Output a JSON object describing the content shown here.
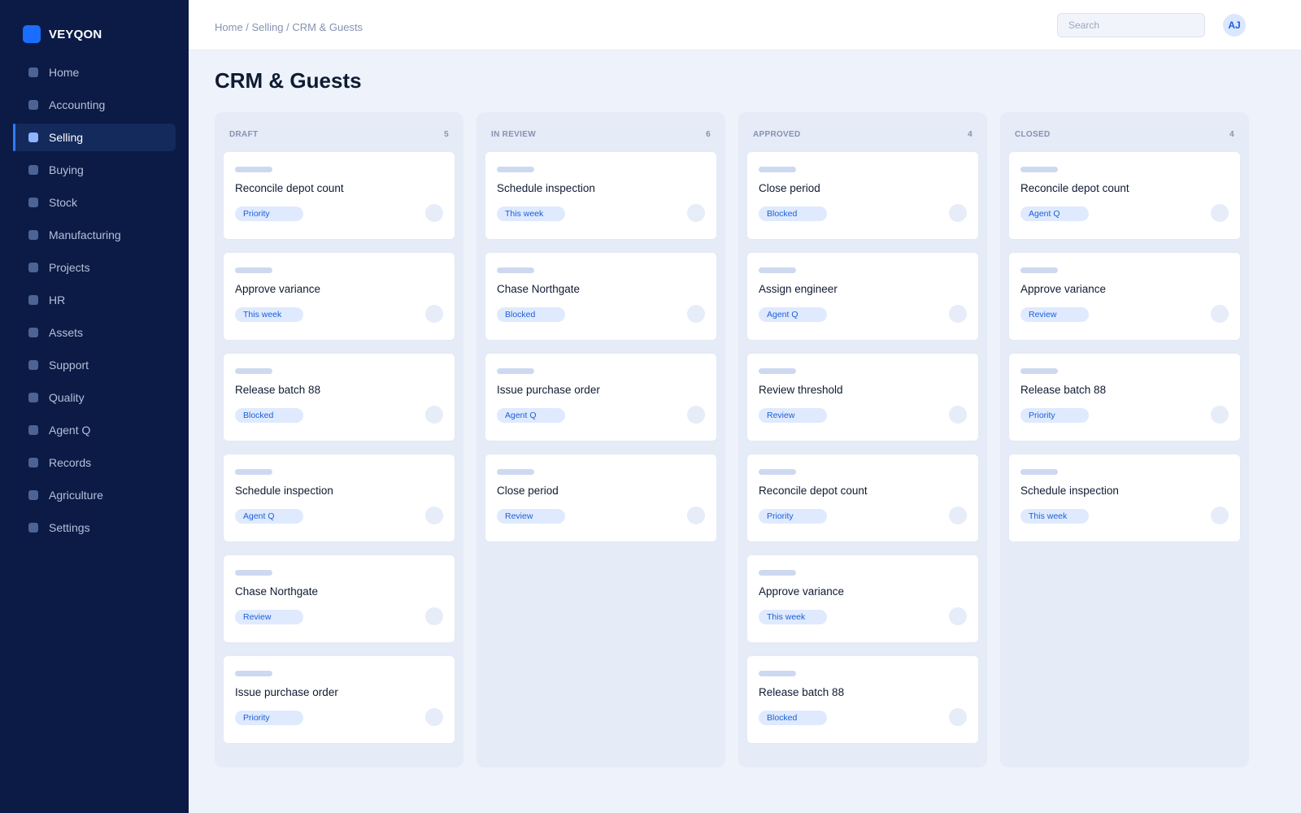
{
  "brand": {
    "name": "VEYQON"
  },
  "sidebar": {
    "items": [
      {
        "label": "Home"
      },
      {
        "label": "Accounting"
      },
      {
        "label": "Selling",
        "active": true
      },
      {
        "label": "Buying"
      },
      {
        "label": "Stock"
      },
      {
        "label": "Manufacturing"
      },
      {
        "label": "Projects"
      },
      {
        "label": "HR"
      },
      {
        "label": "Assets"
      },
      {
        "label": "Support"
      },
      {
        "label": "Quality"
      },
      {
        "label": "Agent Q"
      },
      {
        "label": "Records"
      },
      {
        "label": "Agriculture"
      },
      {
        "label": "Settings"
      }
    ]
  },
  "topbar": {
    "breadcrumb": "Home / Selling / CRM & Guests",
    "search_placeholder": "Search",
    "avatar_initials": "AJ"
  },
  "page": {
    "title": "CRM & Guests"
  },
  "board": {
    "columns": [
      {
        "title": "DRAFT",
        "count": "5",
        "cards": [
          {
            "title": "Reconcile depot count",
            "tag": "Priority"
          },
          {
            "title": "Approve variance",
            "tag": "This week"
          },
          {
            "title": "Release batch 88",
            "tag": "Blocked"
          },
          {
            "title": "Schedule inspection",
            "tag": "Agent Q"
          },
          {
            "title": "Chase Northgate",
            "tag": "Review"
          },
          {
            "title": "Issue purchase order",
            "tag": "Priority"
          }
        ]
      },
      {
        "title": "IN REVIEW",
        "count": "6",
        "cards": [
          {
            "title": "Schedule inspection",
            "tag": "This week"
          },
          {
            "title": "Chase Northgate",
            "tag": "Blocked"
          },
          {
            "title": "Issue purchase order",
            "tag": "Agent Q"
          },
          {
            "title": "Close period",
            "tag": "Review"
          }
        ]
      },
      {
        "title": "APPROVED",
        "count": "4",
        "cards": [
          {
            "title": "Close period",
            "tag": "Blocked"
          },
          {
            "title": "Assign engineer",
            "tag": "Agent Q"
          },
          {
            "title": "Review threshold",
            "tag": "Review"
          },
          {
            "title": "Reconcile depot count",
            "tag": "Priority"
          },
          {
            "title": "Approve variance",
            "tag": "This week"
          },
          {
            "title": "Release batch 88",
            "tag": "Blocked"
          }
        ]
      },
      {
        "title": "CLOSED",
        "count": "4",
        "cards": [
          {
            "title": "Reconcile depot count",
            "tag": "Agent Q"
          },
          {
            "title": "Approve variance",
            "tag": "Review"
          },
          {
            "title": "Release batch 88",
            "tag": "Priority"
          },
          {
            "title": "Schedule inspection",
            "tag": "This week"
          }
        ]
      }
    ]
  }
}
